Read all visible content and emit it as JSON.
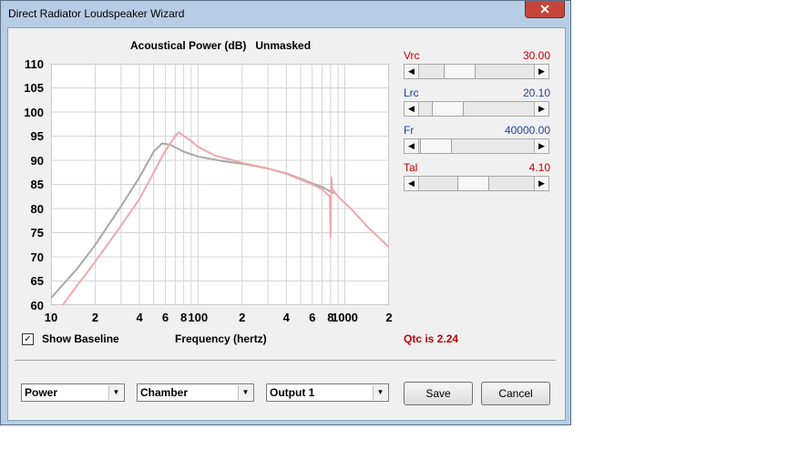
{
  "window": {
    "title": "Direct Radiator Loudspeaker Wizard",
    "close_glyph": "✕"
  },
  "chart": {
    "title": "Acoustical Power (dB)   Unmasked",
    "xlabel": "Frequency (hertz)"
  },
  "chart_data": {
    "type": "line",
    "title": "Acoustical Power (dB)   Unmasked",
    "xlabel": "Frequency (hertz)",
    "ylabel": "",
    "xscale": "log",
    "xlim": [
      10,
      2000
    ],
    "ylim": [
      60,
      110
    ],
    "grid": true,
    "ytick_labels": [
      "110",
      "105",
      "100",
      "95",
      "90",
      "85",
      "80",
      "75",
      "70",
      "65",
      "60"
    ],
    "xtick_labels": [
      {
        "x": 10,
        "label": "10"
      },
      {
        "x": 20,
        "label": "2"
      },
      {
        "x": 40,
        "label": "4"
      },
      {
        "x": 60,
        "label": "6"
      },
      {
        "x": 80,
        "label": "8"
      },
      {
        "x": 100,
        "label": "100"
      },
      {
        "x": 200,
        "label": "2"
      },
      {
        "x": 400,
        "label": "4"
      },
      {
        "x": 600,
        "label": "6"
      },
      {
        "x": 800,
        "label": "8"
      },
      {
        "x": 1000,
        "label": "1000"
      },
      {
        "x": 2000,
        "label": "2"
      }
    ],
    "series": [
      {
        "color": "#a8a8a8",
        "points": [
          [
            10,
            61.5
          ],
          [
            15,
            67.5
          ],
          [
            20,
            72.5
          ],
          [
            30,
            80.5
          ],
          [
            40,
            86.5
          ],
          [
            50,
            91.8
          ],
          [
            57,
            93.5
          ],
          [
            65,
            93.2
          ],
          [
            80,
            91.8
          ],
          [
            100,
            90.8
          ],
          [
            150,
            89.8
          ],
          [
            200,
            89.3
          ],
          [
            300,
            88.3
          ],
          [
            400,
            87.3
          ],
          [
            500,
            86.2
          ],
          [
            600,
            85.2
          ],
          [
            700,
            84.5
          ],
          [
            800,
            83.5
          ],
          [
            850,
            83.2
          ]
        ]
      },
      {
        "color": "#f0a8a8",
        "points": [
          [
            12,
            60.0
          ],
          [
            15,
            64.0
          ],
          [
            20,
            69.0
          ],
          [
            30,
            76.5
          ],
          [
            40,
            82.0
          ],
          [
            50,
            87.5
          ],
          [
            60,
            92.0
          ],
          [
            70,
            95.0
          ],
          [
            74,
            95.8
          ],
          [
            90,
            94.0
          ],
          [
            100,
            92.8
          ],
          [
            130,
            91.0
          ],
          [
            200,
            89.5
          ],
          [
            300,
            88.3
          ],
          [
            400,
            87.2
          ],
          [
            500,
            86.0
          ],
          [
            600,
            85.0
          ],
          [
            700,
            84.0
          ],
          [
            790,
            82.5
          ],
          [
            800,
            74.0
          ],
          [
            810,
            86.5
          ],
          [
            820,
            84.0
          ],
          [
            900,
            82.5
          ],
          [
            1100,
            80.0
          ],
          [
            1400,
            76.5
          ],
          [
            2000,
            72.0
          ]
        ]
      }
    ]
  },
  "params": [
    {
      "label": "Vrc",
      "value": "30.00",
      "color": "#c00000",
      "thumb": 0.3
    },
    {
      "label": "Lrc",
      "value": "20.10",
      "color": "#1f3f9f",
      "thumb": 0.16
    },
    {
      "label": "Fr",
      "value": "40000.00",
      "color": "#1f3f9f",
      "thumb": 0.02
    },
    {
      "label": "Tal",
      "value": "4.10",
      "color": "#c00000",
      "thumb": 0.46
    }
  ],
  "baseline": {
    "label": "Show Baseline",
    "checked": true,
    "check_glyph": "✓"
  },
  "qtc": "Qtc is 2.24",
  "dropdowns": [
    {
      "value": "Power"
    },
    {
      "value": "Chamber"
    },
    {
      "value": "Output 1"
    }
  ],
  "buttons": {
    "save": "Save",
    "cancel": "Cancel"
  }
}
